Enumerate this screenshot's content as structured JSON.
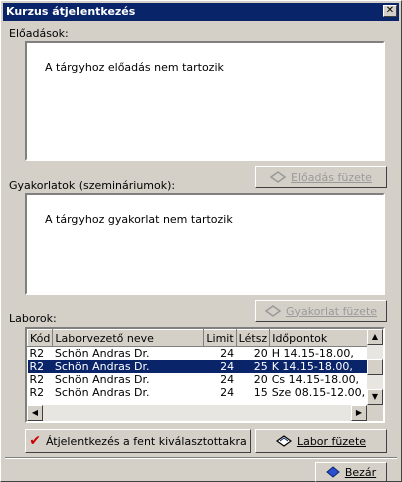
{
  "window": {
    "title": "Kurzus átjelentkezés",
    "close_glyph": "✕"
  },
  "lectures": {
    "label": "Előadások:",
    "empty_message": "A tárgyhoz előadás nem tartozik"
  },
  "lecture_button": {
    "label": "Előadás füzete",
    "icon": "book-icon",
    "enabled": false
  },
  "practicals": {
    "label": "Gyakorlatok (szemináriumok):",
    "empty_message": "A tárgyhoz gyakorlat nem tartozik"
  },
  "practical_button": {
    "label": "Gyakorlat füzete",
    "icon": "book-icon",
    "enabled": false
  },
  "labs": {
    "label": "Laborok:",
    "columns": [
      "Kód",
      "Laborvezető neve",
      "Limit",
      "Létsz",
      "Időpontok"
    ],
    "rows": [
      [
        "R2",
        "Schön Andras Dr.",
        "24",
        "20",
        "H 14.15-18.00,"
      ],
      [
        "R2",
        "Schön Andras Dr.",
        "24",
        "25",
        "K 14.15-18.00,"
      ],
      [
        "R2",
        "Schön Andras Dr.",
        "24",
        "20",
        "Cs 14.15-18.00,"
      ],
      [
        "R2",
        "Schön Andras Dr.",
        "24",
        "15",
        "Sze 08.15-12.00,"
      ]
    ],
    "selected_row": 1
  },
  "transfer_button": {
    "label": "Átjelentkezés a fent kiválasztottakra",
    "icon": "checkmark-icon"
  },
  "lab_button": {
    "label": "Labor füzete",
    "icon": "book-icon"
  },
  "close_button": {
    "label": "Bezár",
    "icon": "diamond-icon"
  }
}
